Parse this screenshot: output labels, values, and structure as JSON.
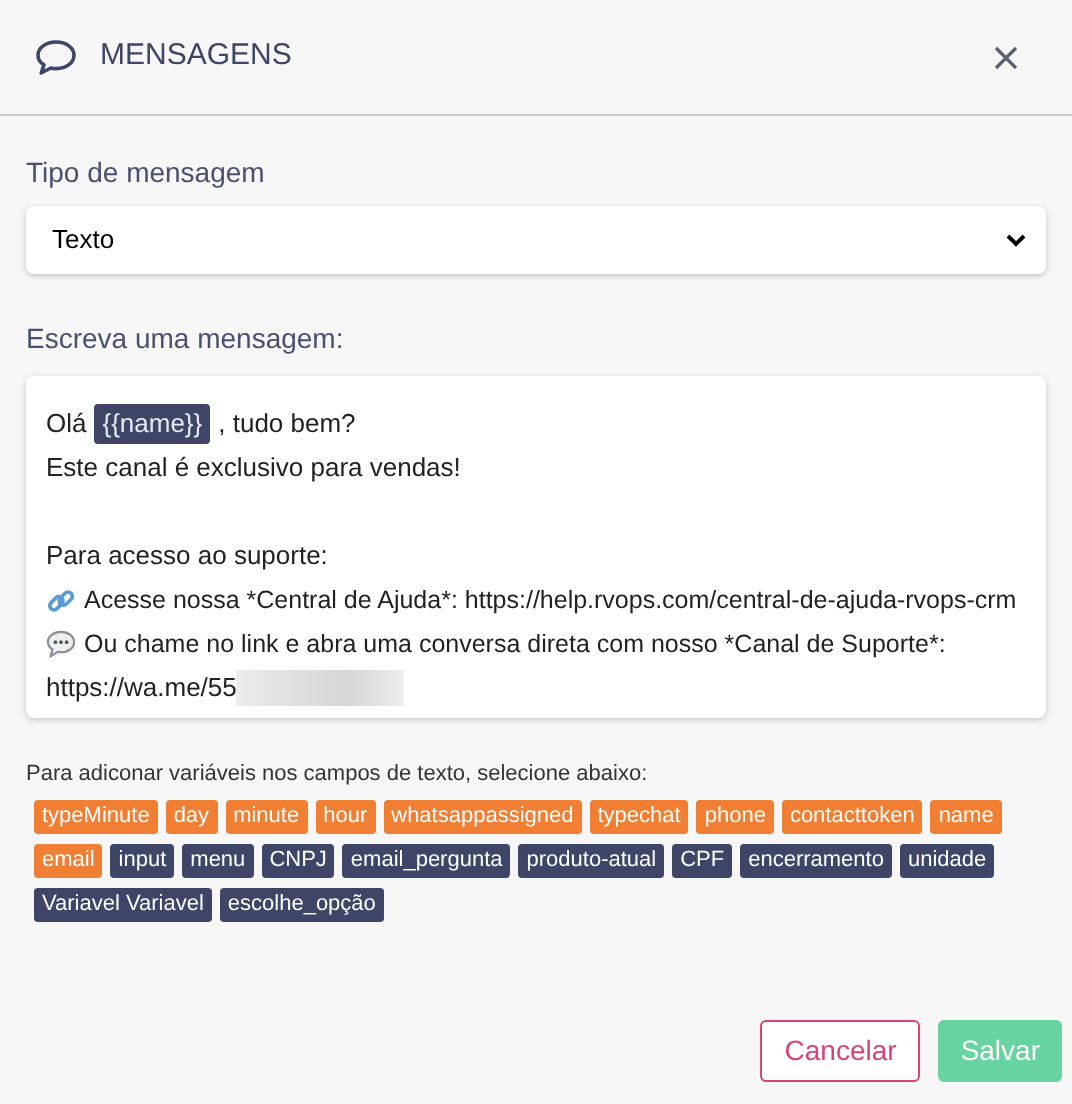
{
  "dialog": {
    "title": "MENSAGENS"
  },
  "message_type": {
    "label": "Tipo de mensagem",
    "value": "Texto"
  },
  "message": {
    "label": "Escreva uma mensagem:",
    "lines": [
      {
        "kind": "variable",
        "before": "Olá",
        "variable": "{{name}}",
        "after": ", tudo bem?"
      },
      {
        "kind": "text",
        "text": "Este canal é exclusivo para vendas!"
      },
      {
        "kind": "blank"
      },
      {
        "kind": "text",
        "text": "Para acesso ao suporte:"
      },
      {
        "kind": "link",
        "text": "Acesse nossa *Central de Ajuda*: https://help.rvops.com/central-de-ajuda-rvops-crm"
      },
      {
        "kind": "chat",
        "text": "Ou chame no link e abra uma conversa direta com nosso *Canal de Suporte*:"
      },
      {
        "kind": "redacted",
        "text": "https://wa.me/55"
      }
    ]
  },
  "variables_hint": "Para adiconar variáveis nos campos de texto, selecione abaixo:",
  "variables": [
    {
      "label": "typeMinute",
      "kind": "system"
    },
    {
      "label": "day",
      "kind": "system"
    },
    {
      "label": "minute",
      "kind": "system"
    },
    {
      "label": "hour",
      "kind": "system"
    },
    {
      "label": "whatsappassigned",
      "kind": "system"
    },
    {
      "label": "typechat",
      "kind": "system"
    },
    {
      "label": "phone",
      "kind": "system"
    },
    {
      "label": "contacttoken",
      "kind": "system"
    },
    {
      "label": "name",
      "kind": "system"
    },
    {
      "label": "email",
      "kind": "system"
    },
    {
      "label": "input",
      "kind": "custom"
    },
    {
      "label": "menu",
      "kind": "custom"
    },
    {
      "label": "CNPJ",
      "kind": "custom"
    },
    {
      "label": "email_pergunta",
      "kind": "custom"
    },
    {
      "label": "produto-atual",
      "kind": "custom"
    },
    {
      "label": "CPF",
      "kind": "custom"
    },
    {
      "label": "encerramento",
      "kind": "custom"
    },
    {
      "label": "unidade",
      "kind": "custom"
    },
    {
      "label": "Variavel Variavel",
      "kind": "custom"
    },
    {
      "label": "escolhe_opção",
      "kind": "custom"
    }
  ],
  "buttons": {
    "cancel": {
      "label": "Cancelar"
    },
    "save": {
      "label": "Salvar",
      "disabled": true
    }
  }
}
